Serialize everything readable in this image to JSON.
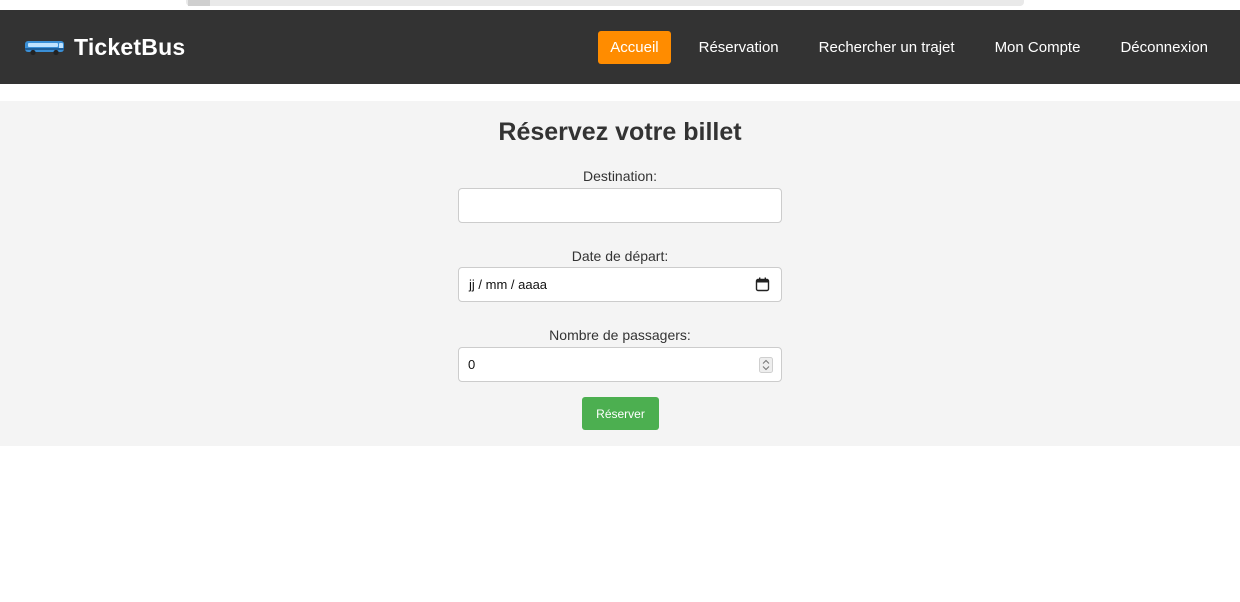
{
  "header": {
    "brand_name": "TicketBus",
    "brand_icon": "bus-icon",
    "nav": [
      {
        "label": "Accueil",
        "active": true
      },
      {
        "label": "Réservation",
        "active": false
      },
      {
        "label": "Rechercher un trajet",
        "active": false
      },
      {
        "label": "Mon Compte",
        "active": false
      },
      {
        "label": "Déconnexion",
        "active": false
      }
    ]
  },
  "form": {
    "title": "Réservez votre billet",
    "destination": {
      "label": "Destination:",
      "value": ""
    },
    "date": {
      "label": "Date de départ:",
      "placeholder": "jj / mm / aaaa",
      "icon": "calendar-icon"
    },
    "passengers": {
      "label": "Nombre de passagers:",
      "value": "0",
      "icon": "spin-icon"
    },
    "submit_label": "Réserver"
  },
  "colors": {
    "header_bg": "#333333",
    "active_nav": "#ff8c00",
    "submit_bg": "#4caf50",
    "form_bg": "#f4f4f4"
  }
}
